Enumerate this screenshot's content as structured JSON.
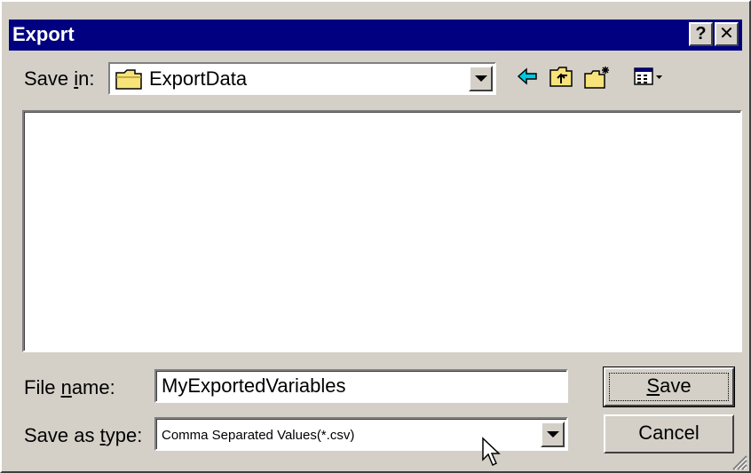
{
  "window": {
    "title": "Export",
    "help_label": "?",
    "close_label": "✕"
  },
  "save_in": {
    "label_pre": "Save ",
    "label_key": "i",
    "label_post": "n:",
    "value": "ExportData"
  },
  "toolbar": {
    "icons": [
      "back-icon",
      "up-folder-icon",
      "new-folder-icon",
      "view-menu-icon"
    ]
  },
  "file_name": {
    "label_pre": "File ",
    "label_key": "n",
    "label_post": "ame:",
    "value": "MyExportedVariables"
  },
  "save_as_type": {
    "label_pre": "Save as ",
    "label_key": "t",
    "label_post": "ype:",
    "value": "Comma Separated Values(*.csv)"
  },
  "buttons": {
    "save_key": "S",
    "save_rest": "ave",
    "cancel": "Cancel"
  },
  "colors": {
    "titlebar": "#000080",
    "face": "#d4d0c8",
    "folder": "#f7e37a",
    "back_arrow": "#00c8e0"
  }
}
